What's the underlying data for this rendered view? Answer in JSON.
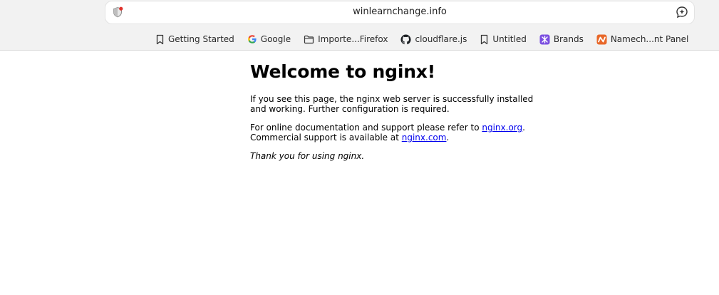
{
  "browser": {
    "url": "winlearnchange.info",
    "bookmarks": [
      {
        "label": "Getting Started",
        "icon": "bookmark-icon"
      },
      {
        "label": "Google",
        "icon": "google-icon"
      },
      {
        "label": "Importe...Firefox",
        "icon": "folder-icon"
      },
      {
        "label": "cloudflare.js",
        "icon": "github-icon"
      },
      {
        "label": "Untitled",
        "icon": "bookmark-icon"
      },
      {
        "label": "Brands",
        "icon": "brands-icon"
      },
      {
        "label": "Namech...nt Panel",
        "icon": "namecheap-icon"
      }
    ]
  },
  "page": {
    "title": "Welcome to nginx!",
    "para1": "If you see this page, the nginx web server is successfully installed and working. Further configuration is required.",
    "para2_prefix": "For online documentation and support please refer to ",
    "link1": "nginx.org",
    "para2_mid": "Commercial support is available at ",
    "link2": "nginx.com",
    "period": ".",
    "thanks": "Thank you for using nginx."
  },
  "colors": {
    "link": "#0000ee",
    "brands_icon": "#7b4fe0",
    "namecheap_icon": "#e8682a"
  }
}
